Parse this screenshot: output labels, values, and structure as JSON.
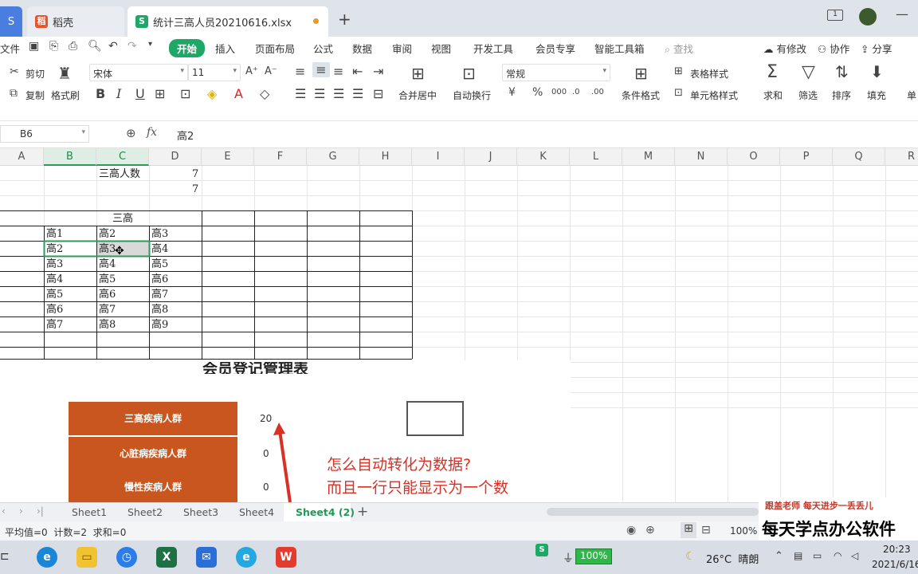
{
  "tabs": [
    {
      "label": "S"
    },
    {
      "label": "稻壳"
    },
    {
      "label": "统计三高人员20210616.xlsx"
    }
  ],
  "menu": {
    "file": "文件",
    "start": "开始",
    "items": [
      "插入",
      "页面布局",
      "公式",
      "数据",
      "审阅",
      "视图",
      "开发工具",
      "会员专享",
      "智能工具箱"
    ],
    "search": "查找",
    "right": [
      "有修改",
      "协作",
      "分享"
    ]
  },
  "ribbon": {
    "cut": "剪切",
    "copy": "复制",
    "format_painter": "格式刷",
    "font": "宋体",
    "size": "11",
    "merge": "合并居中",
    "wrap": "自动换行",
    "number_format": "常规",
    "cond_format": "条件格式",
    "table_style": "表格样式",
    "cell_style": "单元格样式",
    "sum": "求和",
    "filter": "筛选",
    "sort": "排序",
    "fill": "填充",
    "more": "单"
  },
  "formula": {
    "cell": "B6",
    "fx": "fx",
    "value": "高2"
  },
  "columns": [
    "A",
    "B",
    "C",
    "D",
    "E",
    "F",
    "G",
    "H",
    "I",
    "J",
    "K",
    "L",
    "M",
    "N",
    "O",
    "P",
    "Q",
    "R"
  ],
  "sheet": {
    "c1_label": "三高人数",
    "d1": "7",
    "d2": "7",
    "header": "三高",
    "rows": [
      [
        "高1",
        "高2",
        "高3"
      ],
      [
        "高2",
        "高3",
        "高4"
      ],
      [
        "高3",
        "高4",
        "高5"
      ],
      [
        "高4",
        "高5",
        "高6"
      ],
      [
        "高5",
        "高6",
        "高7"
      ],
      [
        "高6",
        "高7",
        "高8"
      ],
      [
        "高7",
        "高8",
        "高9"
      ]
    ]
  },
  "picture": {
    "title": "会员登记管理表",
    "rows": [
      {
        "label": "三高疾病人群",
        "value": "20"
      },
      {
        "label": "心脏病疾病人群",
        "value": "0"
      },
      {
        "label": "慢性疾病人群",
        "value": "0"
      }
    ],
    "note1": "怎么自动转化为数据?",
    "note2": "而且一行只能显示为一个数"
  },
  "sheet_tabs": [
    "Sheet1",
    "Sheet2",
    "Sheet3",
    "Sheet4",
    "Sheet4 (2)"
  ],
  "status": {
    "summary": "平均值=0  计数=2  求和=0",
    "zoom": "100%"
  },
  "watermark": {
    "small": "跟盖老师   每天进步一丢丢儿",
    "big": "每天学点办公软件"
  },
  "taskbar": {
    "battery": "100%",
    "weather": "26°C  晴朗",
    "time": "20:23",
    "date": "2021/6/16"
  },
  "colors": {
    "accent": "#1fa767",
    "orange": "#c8561e",
    "red": "#d93025"
  }
}
